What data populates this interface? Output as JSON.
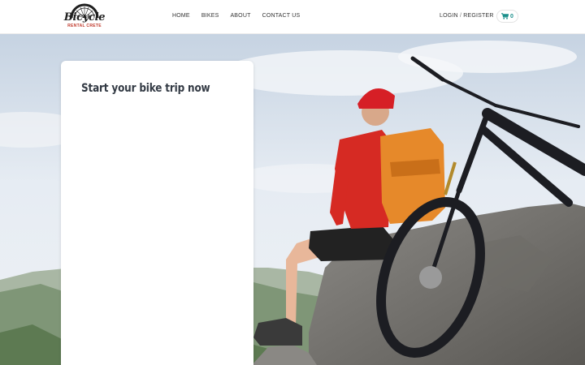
{
  "brand": {
    "name": "Bicycle",
    "tagline": "RENTAL CRETE"
  },
  "nav": {
    "items": [
      {
        "label": "HOME"
      },
      {
        "label": "BIKES"
      },
      {
        "label": "ABOUT"
      },
      {
        "label": "CONTACT US"
      }
    ]
  },
  "account": {
    "login": "LOGIN",
    "separator": "/",
    "register": "REGISTER"
  },
  "cart": {
    "icon": "shopping-cart-icon",
    "count": "0",
    "accent": "#1a8f8b"
  },
  "booking": {
    "title": "Start your bike trip now"
  },
  "colors": {
    "brand_red": "#c0392b",
    "cart_teal": "#1a8f8b",
    "title_text": "#333a44"
  }
}
